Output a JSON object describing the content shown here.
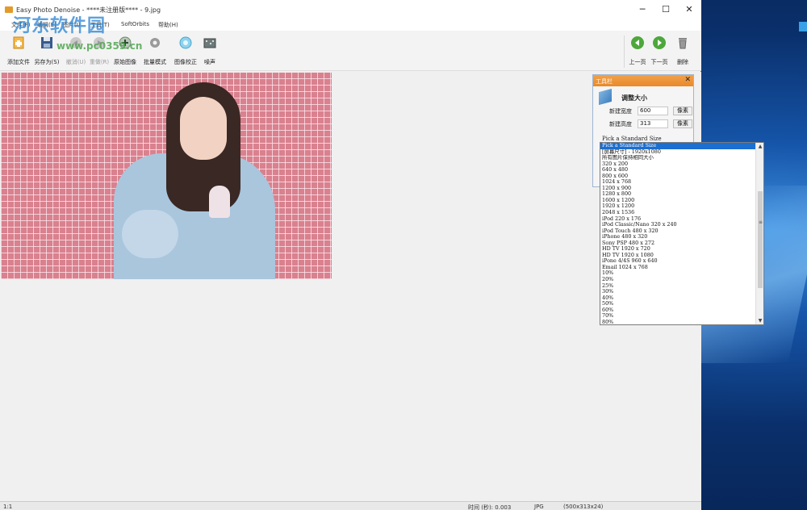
{
  "window": {
    "title": "Easy Photo Denoise - ****未注册版**** - 9.jpg",
    "minimize": "─",
    "maximize": "☐",
    "close": "✕"
  },
  "watermark": {
    "line1": "河东软件园",
    "line2": "www.pc0359.cn"
  },
  "menu": [
    "文件(F)",
    "编辑(E)",
    "图片(I)",
    "工具(T)",
    "SoftOrbits",
    "帮助(H)"
  ],
  "toolbar": {
    "buttons": [
      {
        "label": "添加文件",
        "icon": "add-file-icon",
        "enabled": true
      },
      {
        "label": "另存为(S)",
        "icon": "save-as-icon",
        "enabled": true
      },
      {
        "label": "撤消(U)",
        "icon": "undo-icon",
        "enabled": false
      },
      {
        "label": "重做(R)",
        "icon": "redo-icon",
        "enabled": false
      },
      {
        "label": "原始图像",
        "icon": "original-image-icon",
        "enabled": true
      },
      {
        "label": "批量模式",
        "icon": "batch-mode-icon",
        "enabled": true
      },
      {
        "label": "图像校正",
        "icon": "image-correction-icon",
        "enabled": true
      },
      {
        "label": "噪声",
        "icon": "noise-icon",
        "enabled": true
      }
    ],
    "nav": [
      {
        "label": "上一页",
        "icon": "previous-page-icon"
      },
      {
        "label": "下一页",
        "icon": "next-page-icon"
      },
      {
        "label": "删除",
        "icon": "delete-icon"
      }
    ]
  },
  "panel": {
    "header": "工具栏",
    "close": "✕",
    "title": "调整大小",
    "width_label": "新建宽度",
    "width_value": "600",
    "width_unit": "像素",
    "height_label": "新建高度",
    "height_value": "313",
    "height_unit": "像素",
    "standard_label": "Pick a Standard Size"
  },
  "dropdown": {
    "selected_index": 0,
    "items": [
      "Pick a Standard Size",
      "[屏幕尺寸] - 1920x1080",
      "所有图片保持相同大小",
      "320 x 200",
      "640 x 480",
      "800 x 600",
      "1024 x 768",
      "1200 x 900",
      "1280 x 800",
      "1600 x 1200",
      "1920 x 1200",
      "2048 x 1536",
      "iPod 220 x 176",
      "iPod Classic/Nano 320 x 240",
      "iPod Touch 480 x 320",
      "iPhone 480 x 320",
      "Sony PSP 480 x 272",
      "HD TV 1920 x 720",
      "HD TV 1920 x 1080",
      "iPone 4/4S 960 x 640",
      "Email 1024 x 768",
      "10%",
      "20%",
      "25%",
      "30%",
      "40%",
      "50%",
      "60%",
      "70%",
      "80%"
    ]
  },
  "status": {
    "zoom": "1:1",
    "time": "时间 (秒): 0.003",
    "format": "JPG",
    "size": "(500x313x24)"
  },
  "colors": {
    "panel_header": "#e88a2b",
    "selection": "#1b6fd1",
    "watermark_blue": "#2882d2",
    "watermark_green": "#46a046"
  }
}
